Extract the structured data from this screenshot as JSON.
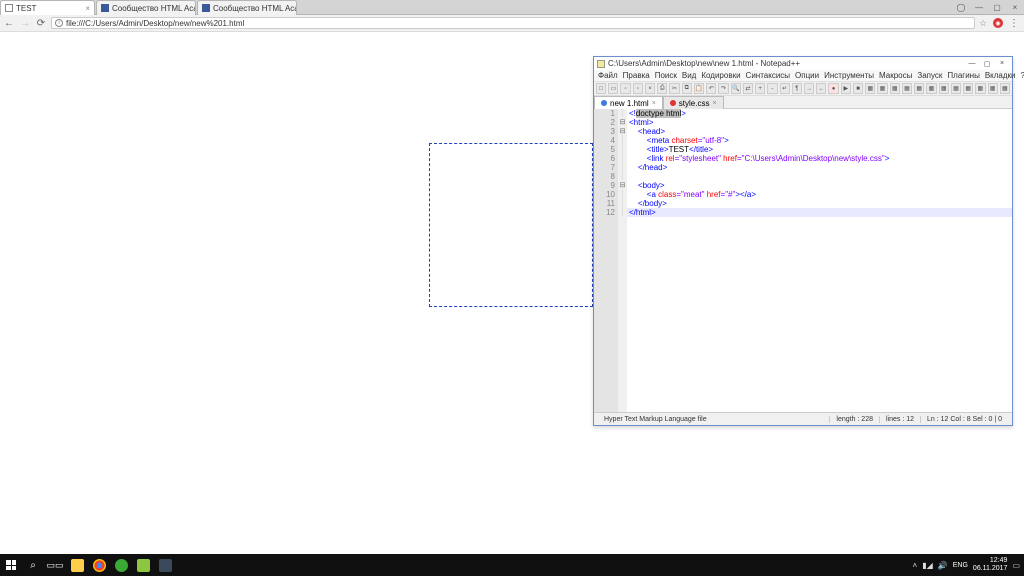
{
  "chrome": {
    "tabs": [
      {
        "title": "TEST",
        "active": true
      },
      {
        "title": "Сообщество HTML Aca",
        "active": false
      },
      {
        "title": "Сообщество HTML Aca",
        "active": false
      }
    ],
    "url": "file:///C:/Users/Admin/Desktop/new/new%201.html"
  },
  "npp": {
    "title_path": "C:\\Users\\Admin\\Desktop\\new\\new 1.html - Notepad++",
    "menu": [
      "Файл",
      "Правка",
      "Поиск",
      "Вид",
      "Кодировки",
      "Синтаксисы",
      "Опции",
      "Инструменты",
      "Макросы",
      "Запуск",
      "Плагины",
      "Вкладки",
      "?"
    ],
    "filetabs": [
      {
        "name": "new 1.html",
        "active": true,
        "dirty": false
      },
      {
        "name": "style.css",
        "active": false,
        "dirty": true
      }
    ],
    "code": [
      {
        "n": 1,
        "tokens": [
          {
            "t": "<!",
            "c": "blue"
          },
          {
            "t": "doctype html",
            "c": "black",
            "bg": true
          },
          {
            "t": ">",
            "c": "blue"
          }
        ]
      },
      {
        "n": 2,
        "fold": "-",
        "tokens": [
          {
            "t": "<",
            "c": "blue"
          },
          {
            "t": "html",
            "c": "blue"
          },
          {
            "t": ">",
            "c": "blue"
          }
        ]
      },
      {
        "n": 3,
        "fold": "-",
        "tokens": [
          {
            "t": "    <",
            "c": "blue"
          },
          {
            "t": "head",
            "c": "blue"
          },
          {
            "t": ">",
            "c": "blue"
          }
        ]
      },
      {
        "n": 4,
        "tokens": [
          {
            "t": "        <",
            "c": "blue"
          },
          {
            "t": "meta ",
            "c": "blue"
          },
          {
            "t": "charset",
            "c": "red"
          },
          {
            "t": "=\"utf-8\"",
            "c": "purple"
          },
          {
            "t": ">",
            "c": "blue"
          }
        ]
      },
      {
        "n": 5,
        "tokens": [
          {
            "t": "        <",
            "c": "blue"
          },
          {
            "t": "title",
            "c": "blue"
          },
          {
            "t": ">",
            "c": "blue"
          },
          {
            "t": "TEST",
            "c": "black"
          },
          {
            "t": "</",
            "c": "blue"
          },
          {
            "t": "title",
            "c": "blue"
          },
          {
            "t": ">",
            "c": "blue"
          }
        ]
      },
      {
        "n": 6,
        "tokens": [
          {
            "t": "        <",
            "c": "blue"
          },
          {
            "t": "link ",
            "c": "blue"
          },
          {
            "t": "rel",
            "c": "red"
          },
          {
            "t": "=\"stylesheet\" ",
            "c": "purple"
          },
          {
            "t": "href",
            "c": "red"
          },
          {
            "t": "=\"C:\\Users\\Admin\\Desktop\\new\\style.css\"",
            "c": "purple"
          },
          {
            "t": ">",
            "c": "blue"
          }
        ]
      },
      {
        "n": 7,
        "tokens": [
          {
            "t": "    </",
            "c": "blue"
          },
          {
            "t": "head",
            "c": "blue"
          },
          {
            "t": ">",
            "c": "blue"
          }
        ]
      },
      {
        "n": 8,
        "tokens": [
          {
            "t": " ",
            "c": "black"
          }
        ]
      },
      {
        "n": 9,
        "fold": "-",
        "tokens": [
          {
            "t": "    <",
            "c": "blue"
          },
          {
            "t": "body",
            "c": "blue"
          },
          {
            "t": ">",
            "c": "blue"
          }
        ]
      },
      {
        "n": 10,
        "tokens": [
          {
            "t": "        <",
            "c": "blue"
          },
          {
            "t": "a ",
            "c": "blue"
          },
          {
            "t": "class",
            "c": "red"
          },
          {
            "t": "=\"meat\" ",
            "c": "purple"
          },
          {
            "t": "href",
            "c": "red"
          },
          {
            "t": "=\"#\"",
            "c": "purple"
          },
          {
            "t": "></",
            "c": "blue"
          },
          {
            "t": "a",
            "c": "blue"
          },
          {
            "t": ">",
            "c": "blue"
          }
        ]
      },
      {
        "n": 11,
        "tokens": [
          {
            "t": "    </",
            "c": "blue"
          },
          {
            "t": "body",
            "c": "blue"
          },
          {
            "t": ">",
            "c": "blue"
          }
        ]
      },
      {
        "n": 12,
        "hl": true,
        "tokens": [
          {
            "t": "</",
            "c": "blue"
          },
          {
            "t": "html",
            "c": "blue"
          },
          {
            "t": ">",
            "c": "blue"
          }
        ]
      }
    ],
    "status": {
      "type": "Hyper Text Markup Language file",
      "length": "length : 228",
      "lines": "lines : 12",
      "pos": "Ln : 12   Col : 8   Sel : 0 | 0"
    }
  },
  "tray": {
    "lang": "ENG",
    "time": "12:49",
    "date": "06.11.2017"
  }
}
